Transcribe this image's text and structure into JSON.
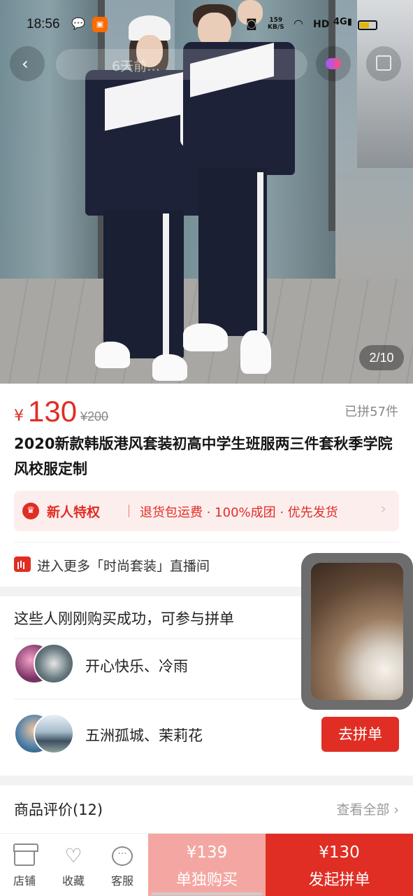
{
  "status_bar": {
    "time": "18:56",
    "net_speed_value": "159",
    "net_speed_unit": "KB/S",
    "network": "HD",
    "signal": "4G",
    "battery_level": 0.6
  },
  "nav": {
    "search_hint": "6天前…"
  },
  "gallery": {
    "counter": "2/10"
  },
  "product": {
    "currency": "¥",
    "price": "130",
    "original_price": "¥200",
    "sold": "已拼57件",
    "title": "2020新款韩版港风套装初高中学生班服两三件套秋季学院风校服定制"
  },
  "privilege": {
    "title": "新人特权",
    "description": "退货包运费 · 100%成团 · 优先发货"
  },
  "live": {
    "text": "进入更多「时尚套装」直播间"
  },
  "group_buy": {
    "title": "这些人刚刚购买成功，可参与拼单",
    "groups": [
      {
        "names": "开心快乐、冷雨"
      },
      {
        "names": "五洲孤城、茉莉花",
        "button": "去拼单"
      }
    ]
  },
  "reviews": {
    "title": "商品评价(12)",
    "view_all": "查看全部"
  },
  "bottom_bar": {
    "store": "店铺",
    "favorite": "收藏",
    "service": "客服",
    "single_price": "¥139",
    "single_label": "单独购买",
    "group_price": "¥130",
    "group_label": "发起拼单"
  },
  "colors": {
    "accent": "#e02e24",
    "accent_light": "#f4a7a2",
    "privilege_bg": "#fdeeee"
  }
}
